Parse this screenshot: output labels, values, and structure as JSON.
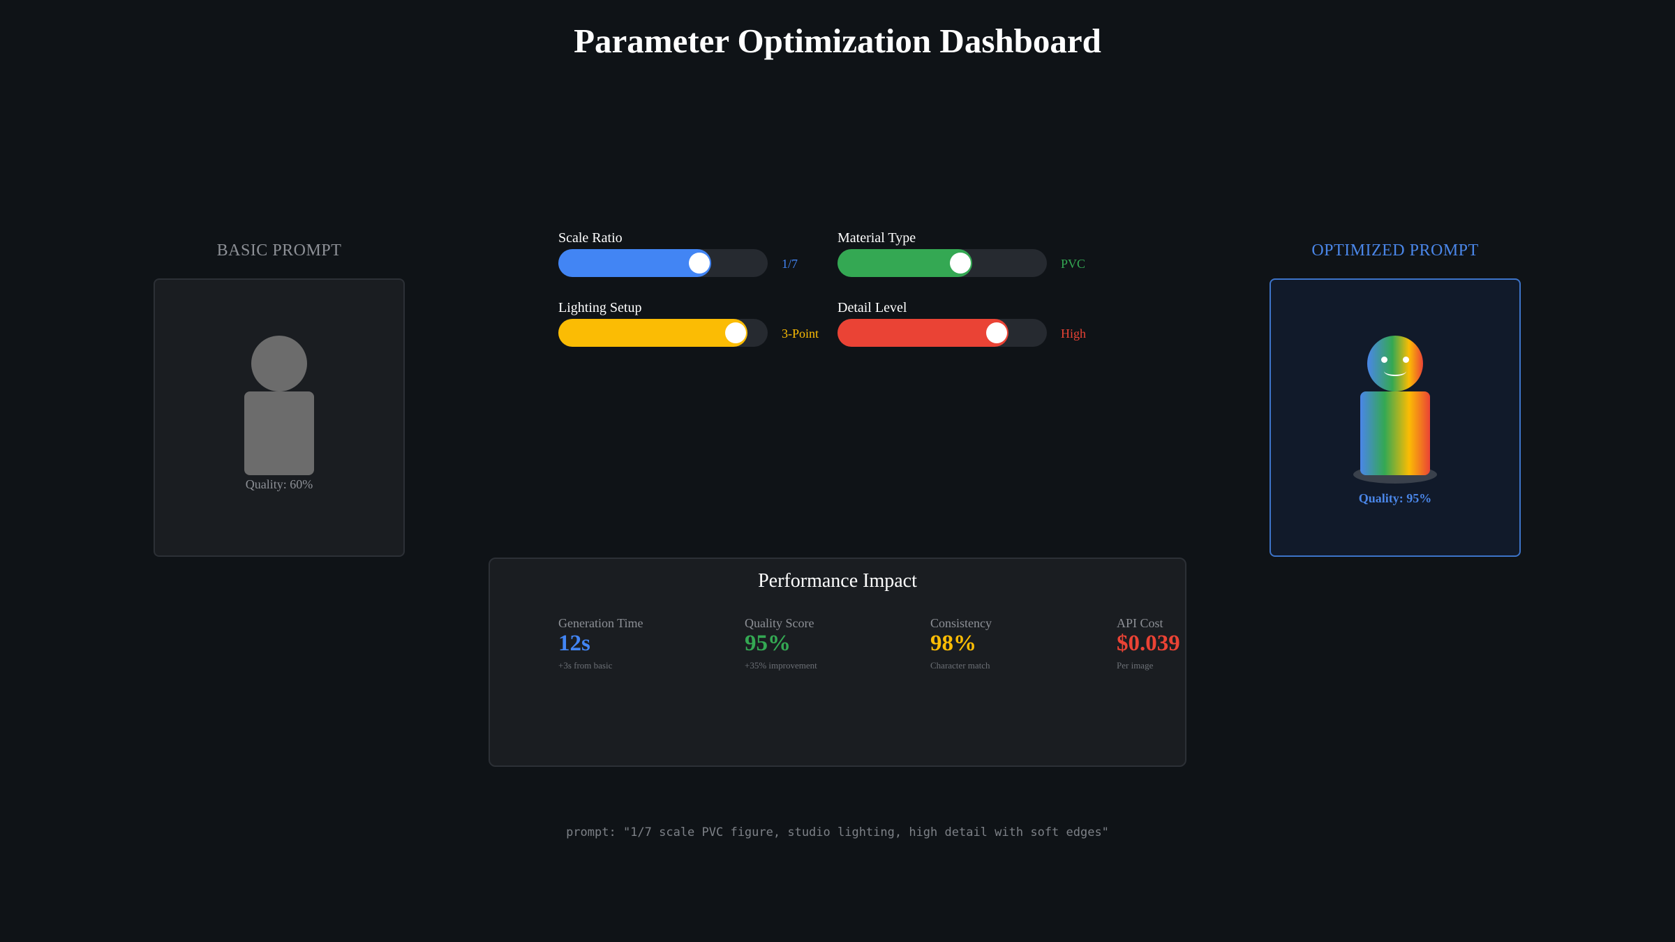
{
  "title": "Parameter Optimization Dashboard",
  "basic": {
    "label": "BASIC PROMPT",
    "quality": "Quality: 60%",
    "figure_color": "#6c6c6c"
  },
  "optimized": {
    "label": "OPTIMIZED PROMPT",
    "quality": "Quality: 95%",
    "accent": "#4a86e8"
  },
  "sliders": [
    {
      "label": "Scale Ratio",
      "value": "1/7",
      "level": 0.7,
      "color": "#4285f4"
    },
    {
      "label": "Material Type",
      "value": "PVC",
      "level": 0.6,
      "color": "#34a853"
    },
    {
      "label": "Lighting Setup",
      "value": "3-Point",
      "level": 0.9,
      "color": "#fbbc04"
    },
    {
      "label": "Detail Level",
      "value": "High",
      "level": 0.8,
      "color": "#ea4335"
    }
  ],
  "performance": {
    "title": "Performance Impact",
    "metrics": [
      {
        "label": "Generation Time",
        "value": "12s",
        "sub": "+3s from basic",
        "color": "#4285f4"
      },
      {
        "label": "Quality Score",
        "value": "95%",
        "sub": "+35% improvement",
        "color": "#34a853"
      },
      {
        "label": "Consistency",
        "value": "98%",
        "sub": "Character match",
        "color": "#fbbc04"
      },
      {
        "label": "API Cost",
        "value": "$0.039",
        "sub": "Per image",
        "color": "#ea4335"
      }
    ]
  },
  "prompt": "prompt: \"1/7 scale PVC figure, studio lighting, high detail with soft edges\""
}
